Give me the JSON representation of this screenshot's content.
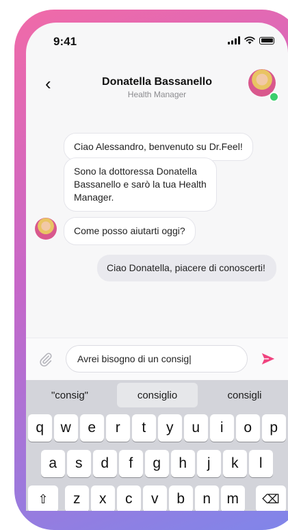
{
  "status_bar": {
    "time": "9:41"
  },
  "header": {
    "back_glyph": "‹",
    "contact_name": "Donatella Bassanello",
    "contact_role": "Health Manager"
  },
  "messages": [
    {
      "from": "doctor",
      "text": "Ciao Alessandro, benvenuto su Dr.Feel!"
    },
    {
      "from": "doctor",
      "text": "Sono la dottoressa Donatella Bassanello e sarò la tua Health Manager."
    },
    {
      "from": "doctor",
      "text": "Come posso aiutarti oggi?"
    },
    {
      "from": "user",
      "text": "Ciao Donatella, piacere di conoscerti!"
    }
  ],
  "composer": {
    "value": "Avrei bisogno di un consig|"
  },
  "keyboard": {
    "suggestions": [
      "\"consig\"",
      "consiglio",
      "consigli"
    ],
    "row1": [
      "q",
      "w",
      "e",
      "r",
      "t",
      "y",
      "u",
      "i",
      "o",
      "p"
    ],
    "row2": [
      "a",
      "s",
      "d",
      "f",
      "g",
      "h",
      "j",
      "k",
      "l"
    ],
    "row3": [
      "z",
      "x",
      "c",
      "v",
      "b",
      "n",
      "m"
    ]
  },
  "colors": {
    "accent": "#f0437f",
    "online": "#3ccf6d",
    "frame_gradient": [
      "#f06aa8",
      "#c667c9",
      "#7f86ea"
    ]
  },
  "icons": [
    "back-chevron-icon",
    "signal-icon",
    "wifi-icon",
    "battery-icon",
    "paperclip-icon",
    "send-icon",
    "shift-icon",
    "backspace-icon"
  ]
}
